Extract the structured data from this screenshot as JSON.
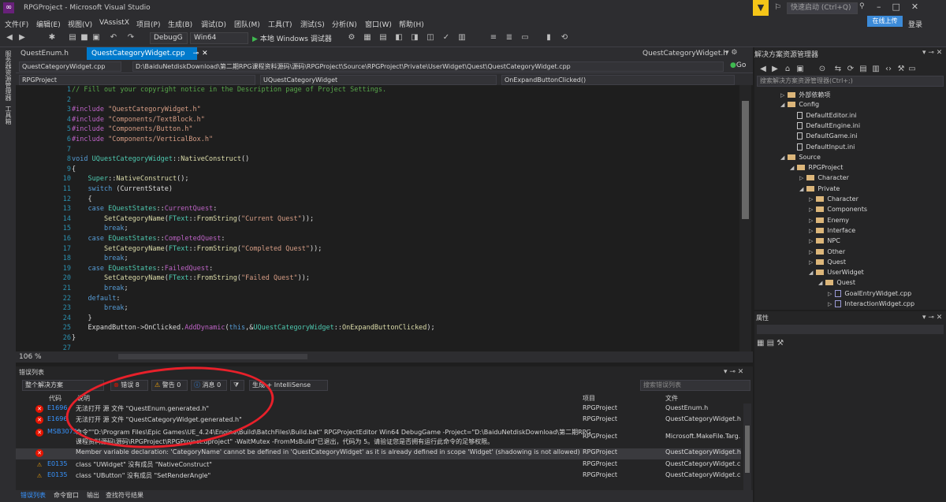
{
  "window": {
    "title": "RPGProject - Microsoft Visual Studio",
    "quick_launch": "快速启动 (Ctrl+Q)",
    "sign_in": "登录",
    "share_button": "在线上传"
  },
  "menu": [
    "文件(F)",
    "编辑(E)",
    "视图(V)",
    "VAssistX",
    "项目(P)",
    "生成(B)",
    "调试(D)",
    "团队(M)",
    "工具(T)",
    "测试(S)",
    "分析(N)",
    "窗口(W)",
    "帮助(H)"
  ],
  "toolbar": {
    "config": "DebugG",
    "platform": "Win64",
    "run_label": "本地 Windows 调试器"
  },
  "left_strip": [
    "服务器资源管理器",
    "工具箱"
  ],
  "tabs": {
    "inactive": "QuestEnum.h",
    "active": "QuestCategoryWidget.cpp",
    "right_file": "QuestCategoryWidget.h"
  },
  "nav": {
    "file": "QuestCategoryWidget.cpp",
    "path": "D:\\BaiduNetdiskDownload\\第二期RPG课程资料源码\\源码\\RPGProject\\Source\\RPGProject\\Private\\UserWidget\\Quest\\QuestCategoryWidget.cpp",
    "go": "Go",
    "project": "RPGProject",
    "class": "UQuestCategoryWidget",
    "member": "OnExpandButtonClicked()"
  },
  "editor": {
    "zoom": "106 %",
    "line_numbers": [
      "1",
      "2",
      "3",
      "4",
      "5",
      "6",
      "7",
      "8",
      "9",
      "10",
      "11",
      "12",
      "13",
      "14",
      "15",
      "16",
      "17",
      "18",
      "19",
      "20",
      "21",
      "22",
      "23",
      "24",
      "25",
      "26",
      "27"
    ]
  },
  "solution_explorer": {
    "title": "解决方案资源管理器",
    "search_placeholder": "搜索解决方案资源管理器(Ctrl+;)",
    "nodes": [
      {
        "label": "外部依赖项",
        "kind": "folder"
      },
      {
        "label": "Config",
        "kind": "folder"
      },
      {
        "label": "DefaultEditor.ini",
        "kind": "ini"
      },
      {
        "label": "DefaultEngine.ini",
        "kind": "ini"
      },
      {
        "label": "DefaultGame.ini",
        "kind": "ini"
      },
      {
        "label": "DefaultInput.ini",
        "kind": "ini"
      },
      {
        "label": "Source",
        "kind": "folder"
      },
      {
        "label": "RPGProject",
        "kind": "folder"
      },
      {
        "label": "Character",
        "kind": "folder"
      },
      {
        "label": "Private",
        "kind": "folder"
      },
      {
        "label": "Character",
        "kind": "folder"
      },
      {
        "label": "Components",
        "kind": "folder"
      },
      {
        "label": "Enemy",
        "kind": "folder"
      },
      {
        "label": "Interface",
        "kind": "folder"
      },
      {
        "label": "NPC",
        "kind": "folder"
      },
      {
        "label": "Other",
        "kind": "folder"
      },
      {
        "label": "Quest",
        "kind": "folder"
      },
      {
        "label": "UserWidget",
        "kind": "folder"
      },
      {
        "label": "Quest",
        "kind": "folder"
      },
      {
        "label": "GoalEntryWidget.cpp",
        "kind": "cpp"
      },
      {
        "label": "InteractionWidget.cpp",
        "kind": "cpp"
      }
    ]
  },
  "properties": {
    "title": "属性"
  },
  "error_list": {
    "title": "错误列表",
    "scope": "整个解决方案",
    "errors_label": "错误 8",
    "warnings_label": "警告 0",
    "messages_label": "消息 0",
    "build_filter": "生成 + IntelliSense",
    "search_placeholder": "搜索错误列表",
    "headers": {
      "code": "代码",
      "description": "说明",
      "project": "项目",
      "file": "文件"
    },
    "rows": [
      {
        "code": "E1696",
        "description": "无法打开 源 文件 \"QuestEnum.generated.h\"",
        "project": "RPGProject",
        "file": "QuestEnum.h"
      },
      {
        "code": "E1696",
        "description": "无法打开 源 文件 \"QuestCategoryWidget.generated.h\"",
        "project": "RPGProject",
        "file": "QuestCategoryWidget.h"
      },
      {
        "code": "MSB3073",
        "description": "命令\"\"D:\\Program Files\\Epic Games\\UE_4.24\\Engine\\Build\\BatchFiles\\Build.bat\" RPGProjectEditor Win64 DebugGame -Project=\"D:\\BaiduNetdiskDownload\\第二期RPG",
        "description2": "课程资料源码\\源码\\RPGProject\\RPGProject.uproject\" -WaitMutex -FromMsBuild\"已退出，代码为 5。请验证您是否拥有运行此命令的足够权限。",
        "project": "RPGProject",
        "file": "Microsoft.MakeFile.Targ..."
      },
      {
        "code": "",
        "description": "Member variable declaration: 'CategoryName' cannot be defined in 'QuestCategoryWidget' as it is already defined in scope 'Widget' (shadowing is not allowed)",
        "project": "RPGProject",
        "file": "QuestCategoryWidget.h"
      },
      {
        "code": "E0135",
        "description": "class \"UWidget\" 没有成员 \"NativeConstruct\"",
        "project": "RPGProject",
        "file": "QuestCategoryWidget.cp"
      },
      {
        "code": "E0135",
        "description": "class \"UButton\" 没有成员 \"SetRenderAngle\"",
        "project": "RPGProject",
        "file": "QuestCategoryWidget.cp"
      }
    ]
  },
  "bottom_tabs": [
    "错误列表",
    "命令窗口",
    "输出",
    "查找符号结果"
  ],
  "colors": {
    "accent": "#007acc",
    "error": "#e51400",
    "annotation": "#e8202a"
  }
}
